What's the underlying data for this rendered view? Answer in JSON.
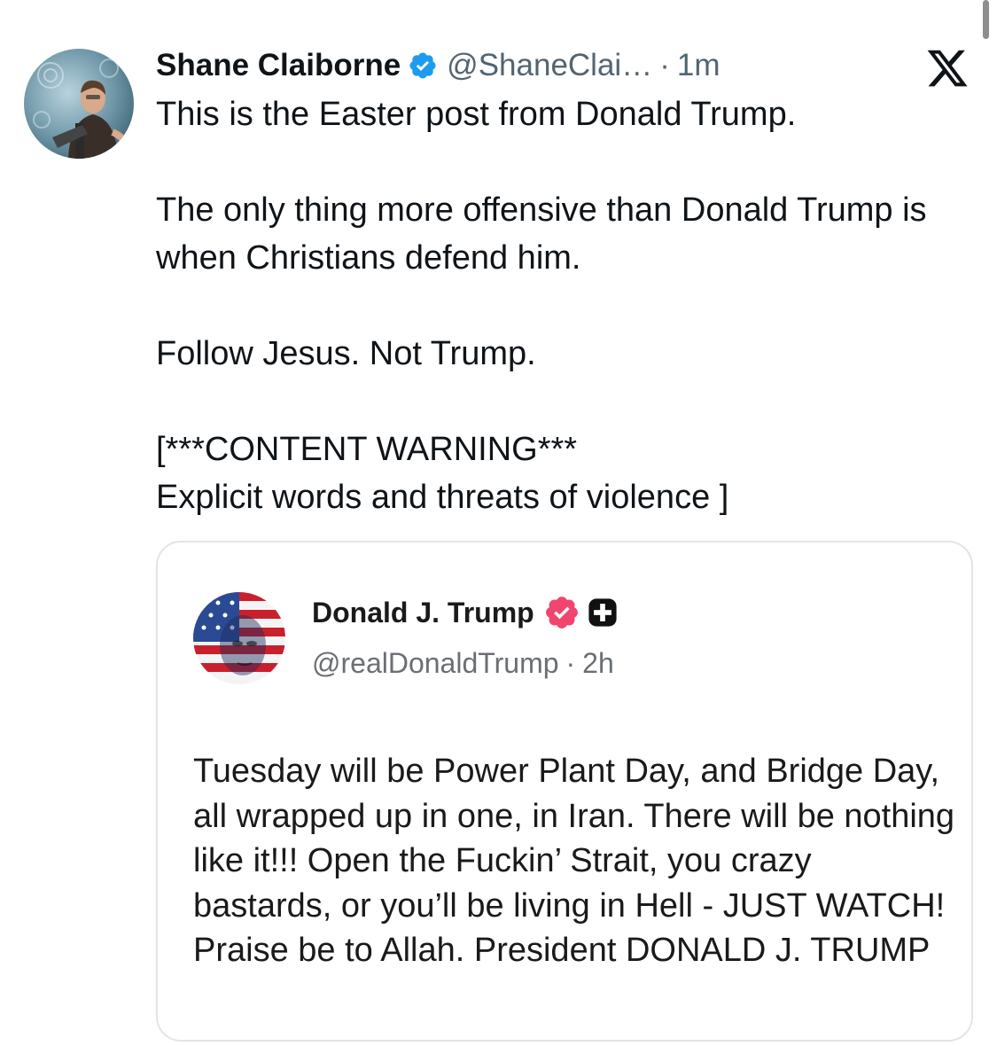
{
  "tweet": {
    "author_name": "Shane Claiborne",
    "handle": "@ShaneClai…",
    "separator": "·",
    "time": "1m",
    "verified_icon": "verified-badge-icon",
    "platform_logo": "x-logo-icon",
    "paragraphs": [
      "This is the Easter post from Donald Trump.",
      "The only thing more offensive than Donald Trump is when Christians defend him.",
      "Follow Jesus. Not Trump.",
      "[***CONTENT WARNING***\nExplicit words and threats of violence ]"
    ]
  },
  "quoted_post": {
    "author_name": "Donald J. Trump",
    "handle": "@realDonaldTrump",
    "separator": "·",
    "time": "2h",
    "badge_icon": "verified-badge-icon",
    "extra_icon": "plus-square-icon",
    "text": "Tuesday will be Power Plant Day, and Bridge Day, all wrapped up in one, in Iran. There will be nothing like it!!! Open the Fuckin’ Strait, you crazy bastards, or you’ll be living in Hell - JUST WATCH! Praise be to Allah. President DONALD J. TRUMP"
  },
  "colors": {
    "text": "#0f1419",
    "secondary": "#536471",
    "verified_blue": "#1d9bf0",
    "truth_badge_pink": "#f0466e",
    "card_border": "#e1e4e8"
  }
}
